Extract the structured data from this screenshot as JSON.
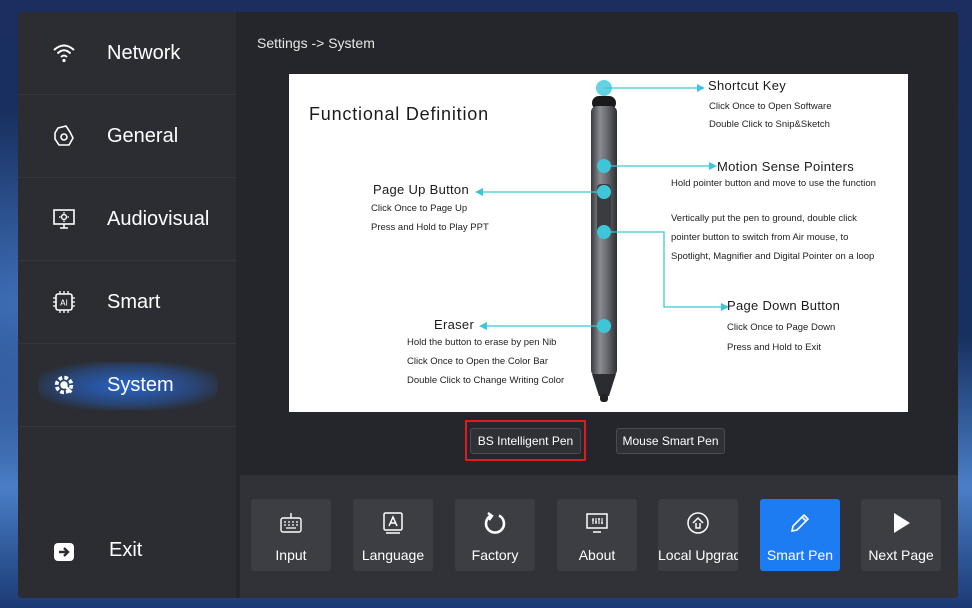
{
  "sidebar": {
    "items": [
      {
        "label": "Network",
        "icon": "wifi-icon"
      },
      {
        "label": "General",
        "icon": "general-settings-icon"
      },
      {
        "label": "Audiovisual",
        "icon": "monitor-icon"
      },
      {
        "label": "Smart",
        "icon": "ai-chip-icon"
      },
      {
        "label": "System",
        "icon": "system-gear-icon",
        "active": true
      }
    ],
    "exit_label": "Exit"
  },
  "breadcrumb": "Settings -> System",
  "figure": {
    "title": "Functional Definition",
    "shortcut": {
      "heading": "Shortcut Key",
      "line1": "Click Once to Open Software",
      "line2": "Double Click to Snip&Sketch"
    },
    "motion": {
      "heading": "Motion Sense Pointers",
      "line1": "Hold pointer button and move to use the function"
    },
    "pointer_mode": {
      "line1": "Vertically put the pen to ground, double click",
      "line2": "pointer button to switch from Air mouse, to",
      "line3": "Spotlight, Magnifier and Digital Pointer on a loop"
    },
    "page_up": {
      "heading": "Page Up Button",
      "line1": "Click Once to Page Up",
      "line2": "Press and Hold to Play PPT"
    },
    "page_down": {
      "heading": "Page Down Button",
      "line1": "Click Once to Page Down",
      "line2": "Press and Hold to Exit"
    },
    "eraser": {
      "heading": "Eraser",
      "line1": "Hold the button to erase by pen Nib",
      "line2": "Click Once to Open the Color Bar",
      "line3": "Double Click to Change Writing Color"
    }
  },
  "pen_options": {
    "bs_label": "BS Intelligent Pen",
    "mouse_label": "Mouse Smart Pen"
  },
  "toolbar": {
    "items": [
      {
        "label": "Input",
        "icon": "keyboard-icon"
      },
      {
        "label": "Language",
        "icon": "language-icon"
      },
      {
        "label": "Factory",
        "icon": "reset-icon"
      },
      {
        "label": "About",
        "icon": "about-monitor-icon"
      },
      {
        "label": "Local Upgrade",
        "icon": "upgrade-icon"
      },
      {
        "label": "Smart Pen",
        "icon": "pen-icon",
        "active": true
      },
      {
        "label": "Next Page",
        "icon": "play-next-icon"
      }
    ]
  },
  "colors": {
    "accent": "#1e7cf2",
    "callout": "#3ec6d8",
    "highlight_box": "#e01b1b"
  }
}
